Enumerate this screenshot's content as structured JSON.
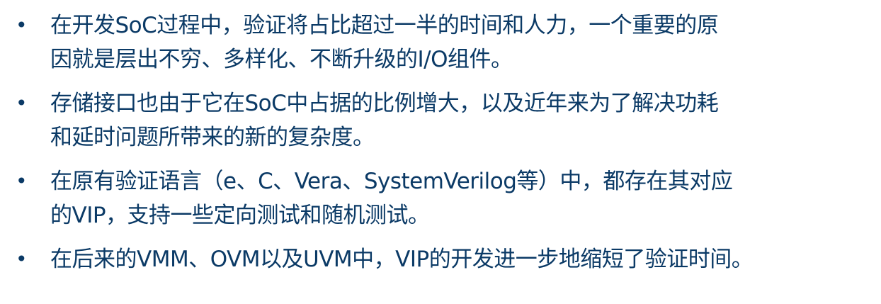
{
  "bullets": [
    {
      "marker": "•",
      "lines": [
        "在开发SoC过程中，验证将占比超过一半的时间和人力，一个重要的原",
        "因就是层出不穷、多样化、不断升级的I/O组件。"
      ]
    },
    {
      "marker": "•",
      "lines": [
        "存储接口也由于它在SoC中占据的比例增大，以及近年来为了解决功耗",
        "和延时问题所带来的新的复杂度。"
      ]
    },
    {
      "marker": "•",
      "lines": [
        "在原有验证语言（e、C、Vera、SystemVerilog等）中，都存在其对应",
        "的VIP，支持一些定向测试和随机测试。"
      ]
    },
    {
      "marker": "•",
      "lines": [
        "在后来的VMM、OVM以及UVM中，VIP的开发进一步地缩短了验证时间。"
      ]
    }
  ]
}
